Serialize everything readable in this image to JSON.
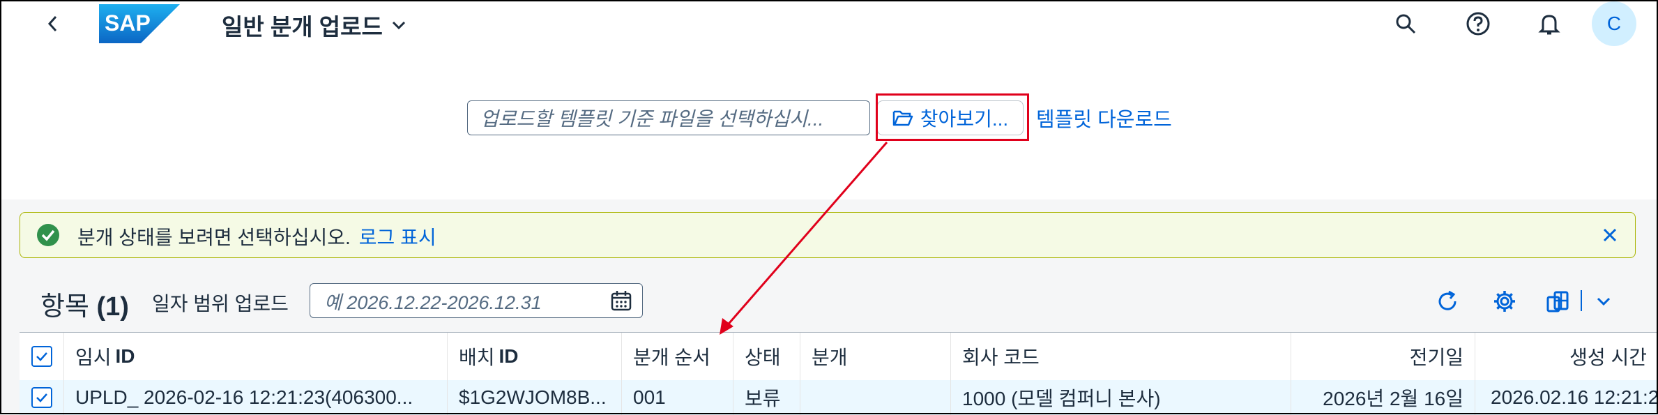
{
  "header": {
    "back_icon": "chevron-left-icon",
    "logo_text": "SAP",
    "app_title": "일반 분개 업로드",
    "title_menu_icon": "chevron-down-icon",
    "search_icon": "search-icon",
    "help_icon": "help-icon",
    "notifications_icon": "bell-icon",
    "avatar_initial": "C"
  },
  "upload": {
    "file_placeholder": "업로드할 템플릿 기준 파일을 선택하십시...",
    "browse_label": "찾아보기...",
    "browse_icon": "folder-open-icon",
    "template_download": "템플릿 다운로드"
  },
  "message": {
    "icon": "success-icon",
    "text": "분개 상태를 보려면 선택하십시오.",
    "link": "로그 표시",
    "close_icon": "close-icon"
  },
  "toolbar": {
    "title": "항목",
    "count": "(1)",
    "date_range_label": "일자 범위 업로드",
    "date_placeholder": "예 2026.12.22-2026.12.31",
    "refresh_icon": "refresh-icon",
    "settings_icon": "gear-icon",
    "export_icon": "excel-export-icon",
    "export_menu_icon": "chevron-down-icon"
  },
  "table": {
    "columns": [
      {
        "label": "임시",
        "bold": "ID"
      },
      {
        "label": "배치",
        "bold": "ID"
      },
      {
        "label": "분개 순서",
        "bold": ""
      },
      {
        "label": "상태",
        "bold": ""
      },
      {
        "label": "분개",
        "bold": ""
      },
      {
        "label": "회사 코드",
        "bold": ""
      },
      {
        "label": "전기일",
        "bold": ""
      },
      {
        "label": "생성 시간",
        "bold": ""
      }
    ],
    "rows": [
      {
        "temp_id": "UPLD_ 2026-02-16 12:21:23(406300...",
        "batch_id": "$1G2WJOM8B...",
        "sequence": "001",
        "status": "보류",
        "journal": "",
        "company_code": "1000 (모델 컴퍼니 본사)",
        "posting_date": "2026년 2월 16일",
        "created": "2026.02.16 12:21:2"
      }
    ]
  },
  "colors": {
    "accent": "#0064d9",
    "highlight": "#e0001b",
    "success": "#30914c"
  }
}
